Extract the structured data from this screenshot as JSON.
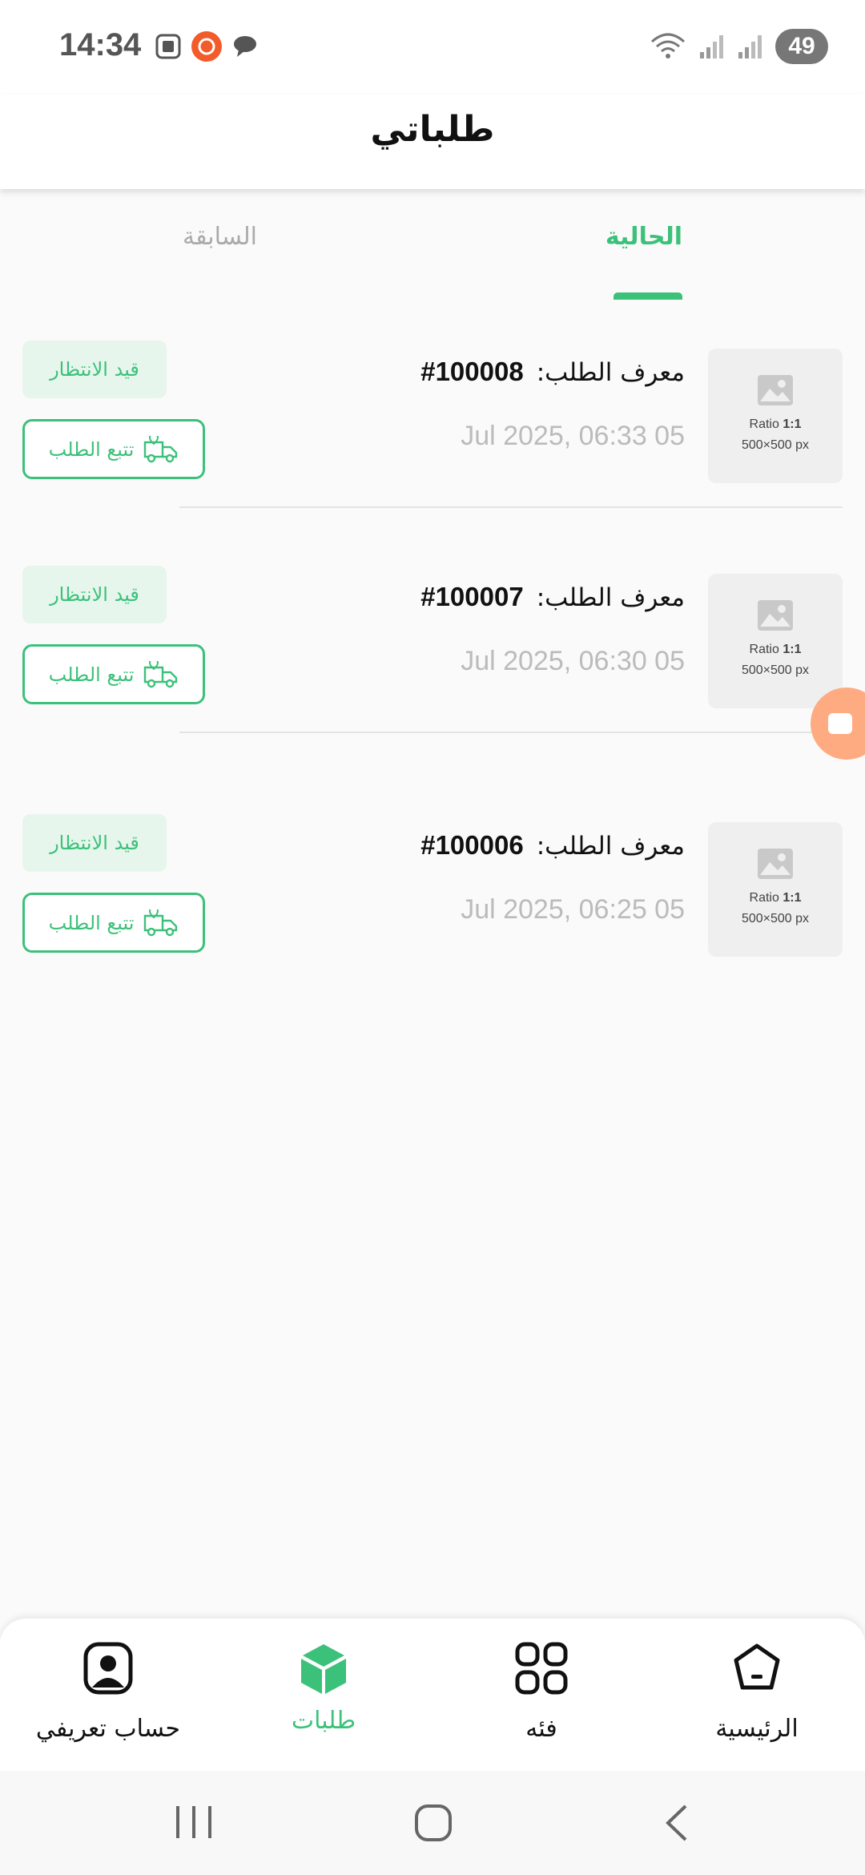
{
  "status_bar": {
    "time": "14:34",
    "battery": "49"
  },
  "header": {
    "title": "طلباتي"
  },
  "tabs": [
    {
      "label": "الحالية",
      "active": true
    },
    {
      "label": "السابقة",
      "active": false
    }
  ],
  "orders": [
    {
      "id_label": "معرف الطلب:",
      "id": "#100008",
      "date": "Jul 2025,  06:33 05",
      "status": "قيد الانتظار",
      "track_label": "تتبع الطلب",
      "thumb_ratio_prefix": "Ratio",
      "thumb_ratio_value": "1:1",
      "thumb_size": "500×500 px"
    },
    {
      "id_label": "معرف الطلب:",
      "id": "#100007",
      "date": "Jul 2025,  06:30 05",
      "status": "قيد الانتظار",
      "track_label": "تتبع الطلب",
      "thumb_ratio_prefix": "Ratio",
      "thumb_ratio_value": "1:1",
      "thumb_size": "500×500 px"
    },
    {
      "id_label": "معرف الطلب:",
      "id": "#100006",
      "date": "Jul 2025,  06:25 05",
      "status": "قيد الانتظار",
      "track_label": "تتبع الطلب",
      "thumb_ratio_prefix": "Ratio",
      "thumb_ratio_value": "1:1",
      "thumb_size": "500×500 px"
    }
  ],
  "bottom_nav": [
    {
      "label": "الرئيسية",
      "icon": "home-icon",
      "active": false
    },
    {
      "label": "فئه",
      "icon": "grid-icon",
      "active": false
    },
    {
      "label": "طلبات",
      "icon": "box-icon",
      "active": true
    },
    {
      "label": "حساب تعريفي",
      "icon": "profile-icon",
      "active": false
    }
  ],
  "colors": {
    "accent": "#3cc17a",
    "badge_bg": "#e6f6ec",
    "floating": "#ffab82"
  }
}
